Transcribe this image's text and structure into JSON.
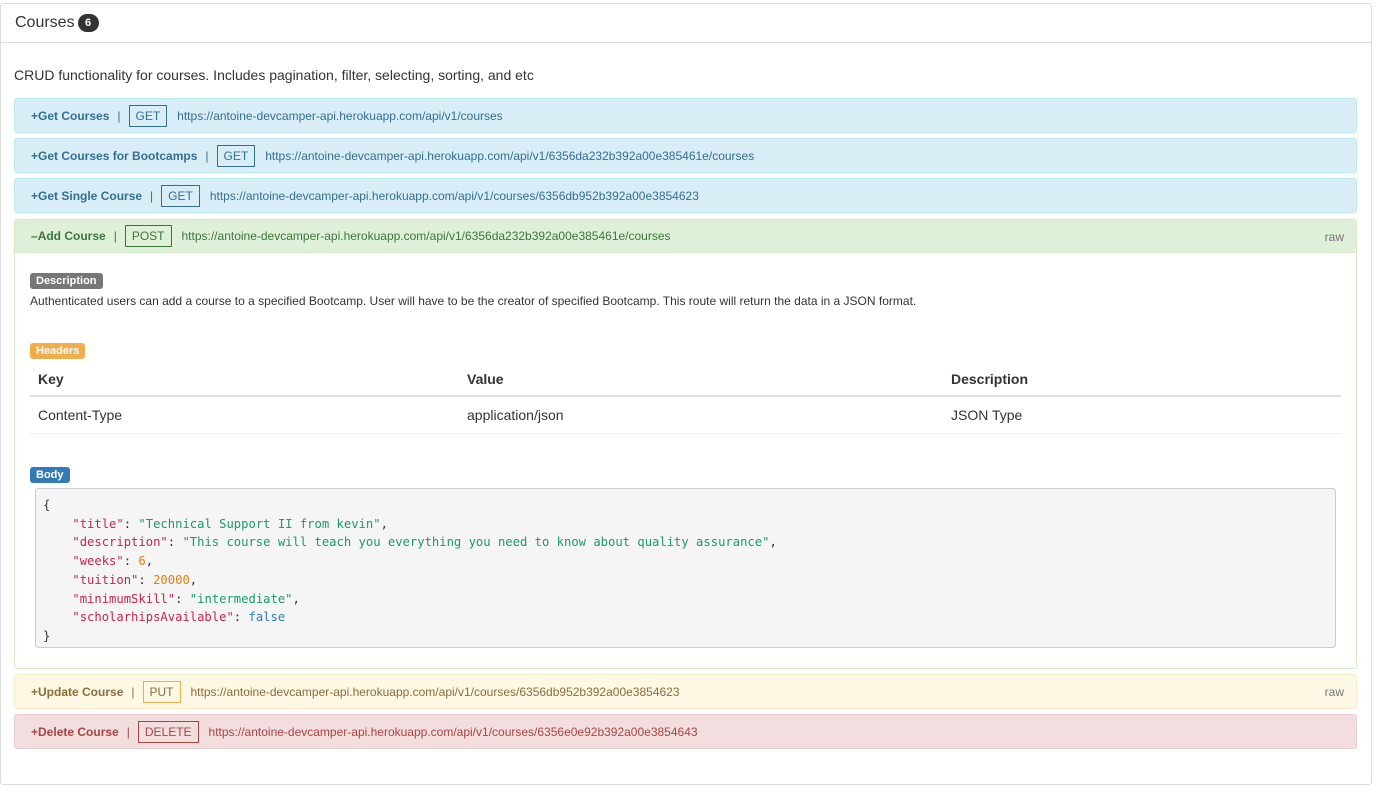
{
  "panel": {
    "title": "Courses",
    "count": "6"
  },
  "description": "CRUD functionality for courses. Includes pagination, filter, selecting, sorting, and etc",
  "separator": "|",
  "routes": [
    {
      "prefix": "+",
      "name": "Get Courses",
      "method": "GET",
      "url": "https://antoine-devcamper-api.herokuapp.com/api/v1/courses"
    },
    {
      "prefix": "+",
      "name": "Get Courses for Bootcamps",
      "method": "GET",
      "url": "https://antoine-devcamper-api.herokuapp.com/api/v1/6356da232b392a00e385461e/courses"
    },
    {
      "prefix": "+",
      "name": "Get Single Course",
      "method": "GET",
      "url": "https://antoine-devcamper-api.herokuapp.com/api/v1/courses/6356db952b392a00e3854623"
    },
    {
      "prefix": "–",
      "name": "Add Course",
      "method": "POST",
      "url": "https://antoine-devcamper-api.herokuapp.com/api/v1/6356da232b392a00e385461e/courses",
      "raw": "raw"
    },
    {
      "prefix": "+",
      "name": "Update Course",
      "method": "PUT",
      "url": "https://antoine-devcamper-api.herokuapp.com/api/v1/courses/6356db952b392a00e3854623",
      "raw": "raw"
    },
    {
      "prefix": "+",
      "name": "Delete Course",
      "method": "DELETE",
      "url": "https://antoine-devcamper-api.herokuapp.com/api/v1/courses/6356e0e92b392a00e3854643"
    }
  ],
  "add_course": {
    "description_label": "Description",
    "description_text": "Authenticated users can add a course to a specified Bootcamp. User will have to be the creator of specified Bootcamp. This route will return the data in a JSON format.",
    "headers_label": "Headers",
    "headers_table": {
      "columns": [
        "Key",
        "Value",
        "Description"
      ],
      "rows": [
        [
          "Content-Type",
          "application/json",
          "JSON Type"
        ]
      ]
    },
    "body_label": "Body",
    "body": {
      "open": "{",
      "close": "}",
      "fields": [
        {
          "key": "\"title\"",
          "value": "\"Technical Support II from kevin\"",
          "kind": "s"
        },
        {
          "key": "\"description\"",
          "value": "\"This course will teach you everything you need to know about quality assurance\"",
          "kind": "s"
        },
        {
          "key": "\"weeks\"",
          "value": "6",
          "kind": "n"
        },
        {
          "key": "\"tuition\"",
          "value": "20000",
          "kind": "n"
        },
        {
          "key": "\"minimumSkill\"",
          "value": "\"intermediate\"",
          "kind": "s"
        },
        {
          "key": "\"scholarhipsAvailable\"",
          "value": "false",
          "kind": "b"
        }
      ]
    }
  }
}
